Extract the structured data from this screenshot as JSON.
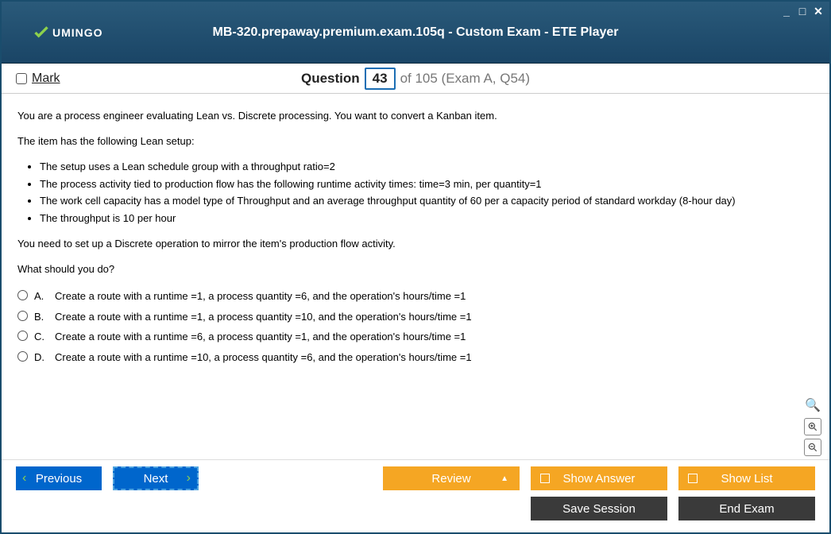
{
  "window": {
    "title": "MB-320.prepaway.premium.exam.105q - Custom Exam - ETE Player",
    "logo_text": "UMINGO"
  },
  "header": {
    "mark_label": "Mark",
    "question_label": "Question",
    "question_number": "43",
    "question_rest": "of 105 (Exam A, Q54)"
  },
  "question": {
    "p1": "You are a process engineer evaluating Lean vs. Discrete processing. You want to convert a Kanban item.",
    "p2": "The item has the following Lean setup:",
    "bullets": [
      "The setup uses a Lean schedule group with a throughput ratio=2",
      "The process activity tied to production flow has the following runtime activity times: time=3 min, per quantity=1",
      "The work cell capacity has a model type of Throughput and an average throughput quantity of 60 per a capacity period of standard workday (8-hour day)",
      "The throughput is 10 per hour"
    ],
    "p3": "You need to set up a Discrete operation to mirror the item's production flow activity.",
    "p4": "What should you do?",
    "options": [
      {
        "letter": "A.",
        "text": "Create a route with a runtime =1, a process quantity =6, and the operation's hours/time =1"
      },
      {
        "letter": "B.",
        "text": "Create a route with a runtime =1, a process quantity =10, and the operation's hours/time =1"
      },
      {
        "letter": "C.",
        "text": "Create a route with a runtime =6, a process quantity =1, and the operation's hours/time =1"
      },
      {
        "letter": "D.",
        "text": "Create a route with a runtime =10, a process quantity =6, and the operation's hours/time =1"
      }
    ]
  },
  "footer": {
    "previous": "Previous",
    "next": "Next",
    "review": "Review",
    "show_answer": "Show Answer",
    "show_list": "Show List",
    "save_session": "Save Session",
    "end_exam": "End Exam"
  }
}
